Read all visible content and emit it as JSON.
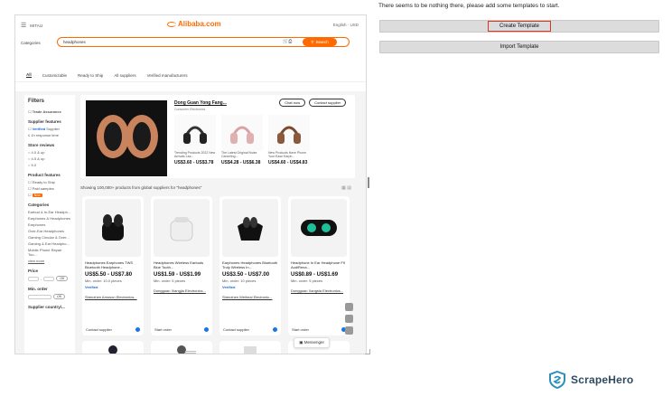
{
  "right_panel": {
    "message": "There seems to be nothing there, please add some templates to start.",
    "create_button": "Create Template",
    "import_button": "Import Template"
  },
  "branding": {
    "logo_text": "ScrapeHero",
    "accent": "#2f8fb8"
  },
  "site": {
    "brand": "MITAIJ",
    "logo": "Alibaba.com",
    "top_right": "English · USD",
    "categories_label": "Categories",
    "search_value": "headphones",
    "search_button": "Search",
    "tabs": [
      "All",
      "Customizable",
      "Ready to Ship",
      "All suppliers",
      "Verified manufacturers"
    ],
    "filters": {
      "title": "Filters",
      "trade_assurance": "Trade Assurance",
      "supplier_features": "Supplier features",
      "verified_supplier": "Supplier",
      "response": "≤ 1h response time",
      "store_reviews": "Store reviews",
      "r1": "4.0 & up",
      "r2": "4.5 & up",
      "r3": "5.0",
      "product_features": "Product features",
      "ready": "Ready to Ship",
      "paid": "Paid samples",
      "new": "New",
      "categories": "Categories",
      "cats": [
        "Earbud & In-Ear Headph...",
        "Earphones & Headphones",
        "Earphones",
        "Over-Ear Headphones",
        "Gaming Circular & Over...",
        "Gaming & Ear Headpho...",
        "Mobile Phone Repair Too..."
      ],
      "view_more": "view more",
      "price": "Price",
      "min_order": "Min. order",
      "supplier_country": "Supplier country/...",
      "ok": "OK"
    },
    "featured": {
      "company": "Dong Guan Yong Fang...",
      "sub": "Consumer Electronics",
      "chat": "Chat now",
      "contact": "Contact supplier",
      "products": [
        {
          "title": "Trending Products 2022 New Arrivals Lea...",
          "price": "US$3.60 - US$3.78"
        },
        {
          "title": "The Latest Original Noise Canceling...",
          "price": "US$4.28 - US$6.38"
        },
        {
          "title": "New Products Have Phone Your Ease Earph...",
          "price": "US$4.60 - US$4.83"
        }
      ]
    },
    "showing": "Showing 100,000+ products from global suppliers for \"headphones\"",
    "products": [
      {
        "title": "Headphones Earphones TWS Bluetooth Headphone...",
        "price": "US$5.50 - US$7.80",
        "moq": "Min. order: 10.0 pieces",
        "supplier": "Shenzhen Amoson Electronics...",
        "action": "Contact supplier"
      },
      {
        "title": "Headphones Wireless Earbuds Blue Tooth...",
        "price": "US$1.59 - US$1.99",
        "moq": "Min. order: 5 pieces",
        "supplier": "Dongguan Xiangjia Electronics...",
        "action": "Start order"
      },
      {
        "title": "Earphones Headphones Bluetooth Truly Wireless In...",
        "price": "US$3.50 - US$7.00",
        "moq": "Min. order: 10 pieces",
        "supplier": "Shenzhen Weiheai Electronic...",
        "action": "Contact supplier"
      },
      {
        "title": "Headphone In Ear Headphone F9 AudiRena...",
        "price": "US$0.89 - US$1.69",
        "moq": "Min. order: 5 pieces",
        "supplier": "Dongguan Xangsia Electronics...",
        "action": "Start order"
      }
    ],
    "verified": "Verified",
    "messenger": "Messenger"
  }
}
